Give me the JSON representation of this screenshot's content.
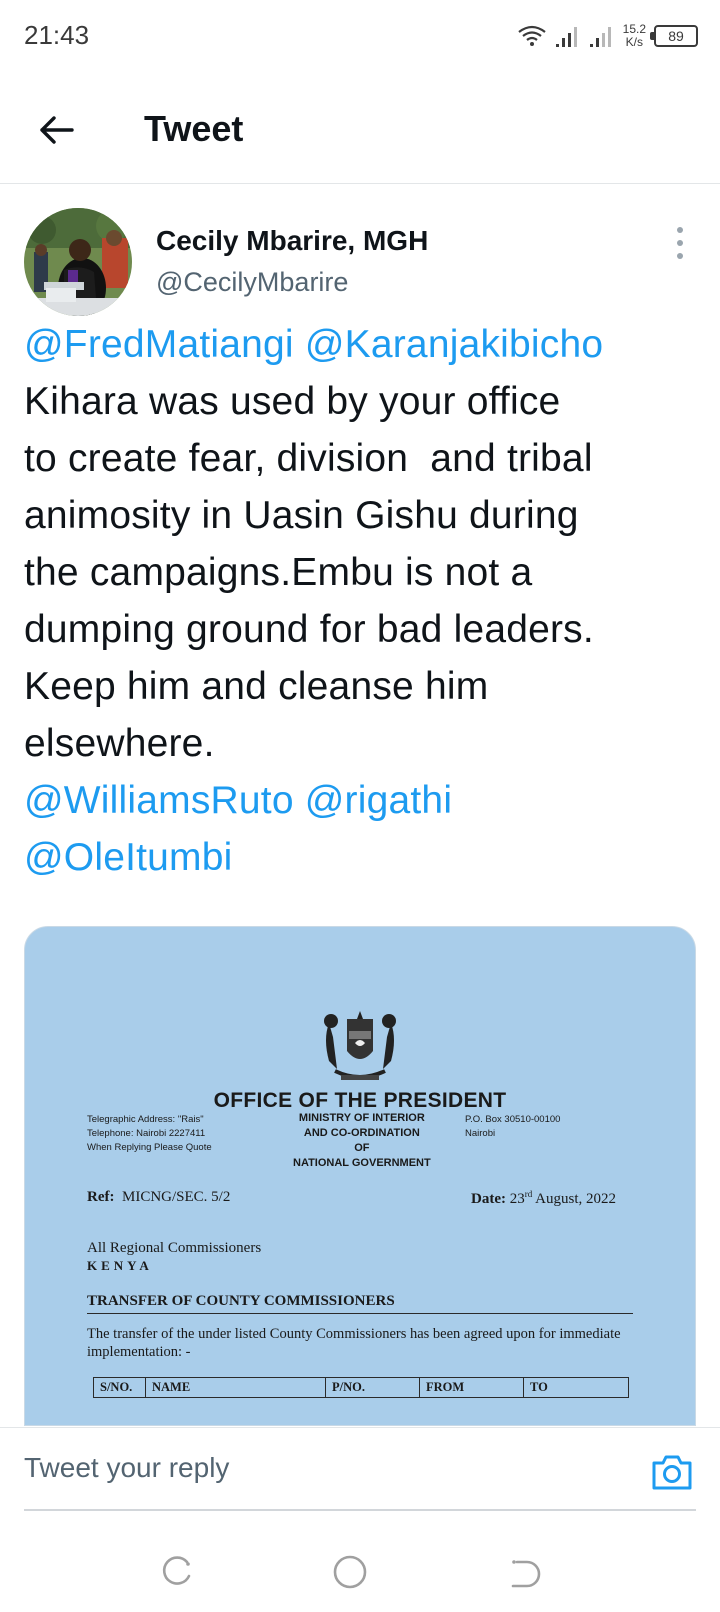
{
  "status_bar": {
    "time": "21:43",
    "net_speed_value": "15.2",
    "net_speed_unit": "K/s",
    "battery": "89"
  },
  "header": {
    "title": "Tweet",
    "back_icon": "arrow-left-icon"
  },
  "tweet": {
    "author_name": "Cecily Mbarire, MGH",
    "author_handle": "@CecilyMbarire",
    "text_lines": [
      [
        {
          "t": "@FredMatiangi",
          "m": true
        },
        {
          "t": " ",
          "m": false
        },
        {
          "t": "@Karanjakibicho",
          "m": true
        }
      ],
      [
        {
          "t": "Kihara was used by your office",
          "m": false
        }
      ],
      [
        {
          "t": "to create fear, division  and tribal",
          "m": false
        }
      ],
      [
        {
          "t": "animosity in Uasin Gishu during",
          "m": false
        }
      ],
      [
        {
          "t": "the campaigns.Embu is not a",
          "m": false
        }
      ],
      [
        {
          "t": "dumping ground for bad leaders.",
          "m": false
        }
      ],
      [
        {
          "t": "Keep him and cleanse him",
          "m": false
        }
      ],
      [
        {
          "t": "elsewhere.",
          "m": false
        }
      ],
      [
        {
          "t": "@WilliamsRuto",
          "m": true
        },
        {
          "t": " ",
          "m": false
        },
        {
          "t": "@rigathi",
          "m": true
        }
      ],
      [
        {
          "t": "@OleItumbi",
          "m": true
        }
      ]
    ],
    "mention_color": "#1d9bf0"
  },
  "media": {
    "office": "OFFICE OF THE PRESIDENT",
    "left_lines": [
      "Telegraphic Address: \"Rais\"",
      "Telephone: Nairobi 2227411",
      "When Replying Please Quote"
    ],
    "mid_lines": [
      "MINISTRY OF INTERIOR",
      "AND CO-ORDINATION",
      "OF",
      "NATIONAL GOVERNMENT"
    ],
    "right_lines": [
      "P.O. Box 30510-00100",
      "Nairobi"
    ],
    "ref_label": "Ref:",
    "ref_value": "MICNG/SEC. 5/2",
    "date_label": "Date:",
    "date_day": "23",
    "date_suffix": "rd",
    "date_rest": " August, 2022",
    "recipient": "All Regional Commissioners",
    "country": "KENYA",
    "subject": "TRANSFER OF COUNTY COMMISSIONERS",
    "body": "The transfer of the under listed County Commissioners has been agreed upon for immediate implementation: -",
    "table_headers": [
      "S/NO.",
      "NAME",
      "P/NO.",
      "FROM",
      "TO"
    ]
  },
  "reply": {
    "placeholder": "Tweet your reply",
    "camera_icon": "camera-icon",
    "accent_color": "#1d9bf0"
  },
  "nav": {
    "recent_icon": "recent-apps-icon",
    "home_icon": "home-icon",
    "back_icon": "back-icon"
  }
}
